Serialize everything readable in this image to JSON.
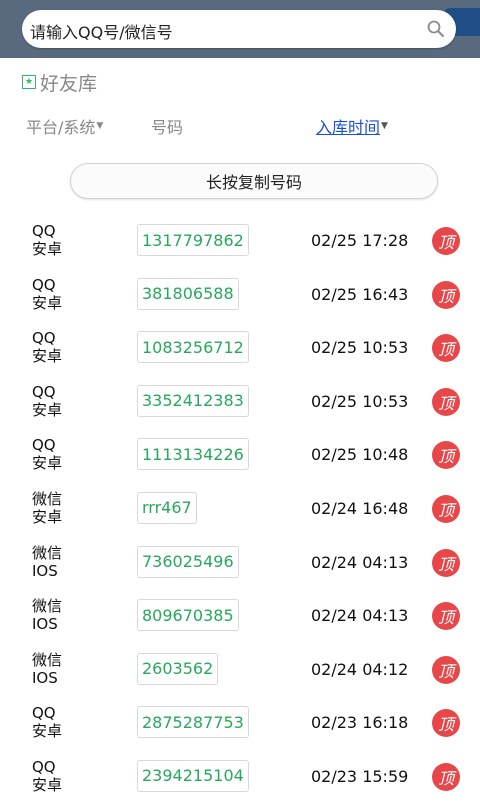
{
  "search": {
    "placeholder": "请输入QQ号/微信号",
    "icon": "search-icon"
  },
  "section": {
    "title": "好友库",
    "icon": "star-icon"
  },
  "columns": {
    "platform": "平台/系统",
    "number": "号码",
    "time": "入库时间"
  },
  "copy_button_label": "长按复制号码",
  "top_button_label": "顶",
  "colors": {
    "accent_green": "#27a85c",
    "top_button_red": "#e8474a",
    "link_blue": "#1a4fd6",
    "topbar_gray": "#5a6a7e"
  },
  "rows": [
    {
      "app": "QQ",
      "os": "安卓",
      "number": "1317797862",
      "time": "02/25 17:28"
    },
    {
      "app": "QQ",
      "os": "安卓",
      "number": "381806588",
      "time": "02/25 16:43"
    },
    {
      "app": "QQ",
      "os": "安卓",
      "number": "1083256712",
      "time": "02/25 10:53"
    },
    {
      "app": "QQ",
      "os": "安卓",
      "number": "3352412383",
      "time": "02/25 10:53"
    },
    {
      "app": "QQ",
      "os": "安卓",
      "number": "1113134226",
      "time": "02/25 10:48"
    },
    {
      "app": "微信",
      "os": "安卓",
      "number": "rrr467",
      "time": "02/24 16:48"
    },
    {
      "app": "微信",
      "os": "IOS",
      "number": "736025496",
      "time": "02/24 04:13"
    },
    {
      "app": "微信",
      "os": "IOS",
      "number": "809670385",
      "time": "02/24 04:13"
    },
    {
      "app": "微信",
      "os": "IOS",
      "number": "2603562",
      "time": "02/24 04:12"
    },
    {
      "app": "QQ",
      "os": "安卓",
      "number": "2875287753",
      "time": "02/23 16:18"
    },
    {
      "app": "QQ",
      "os": "安卓",
      "number": "2394215104",
      "time": "02/23 15:59"
    }
  ]
}
